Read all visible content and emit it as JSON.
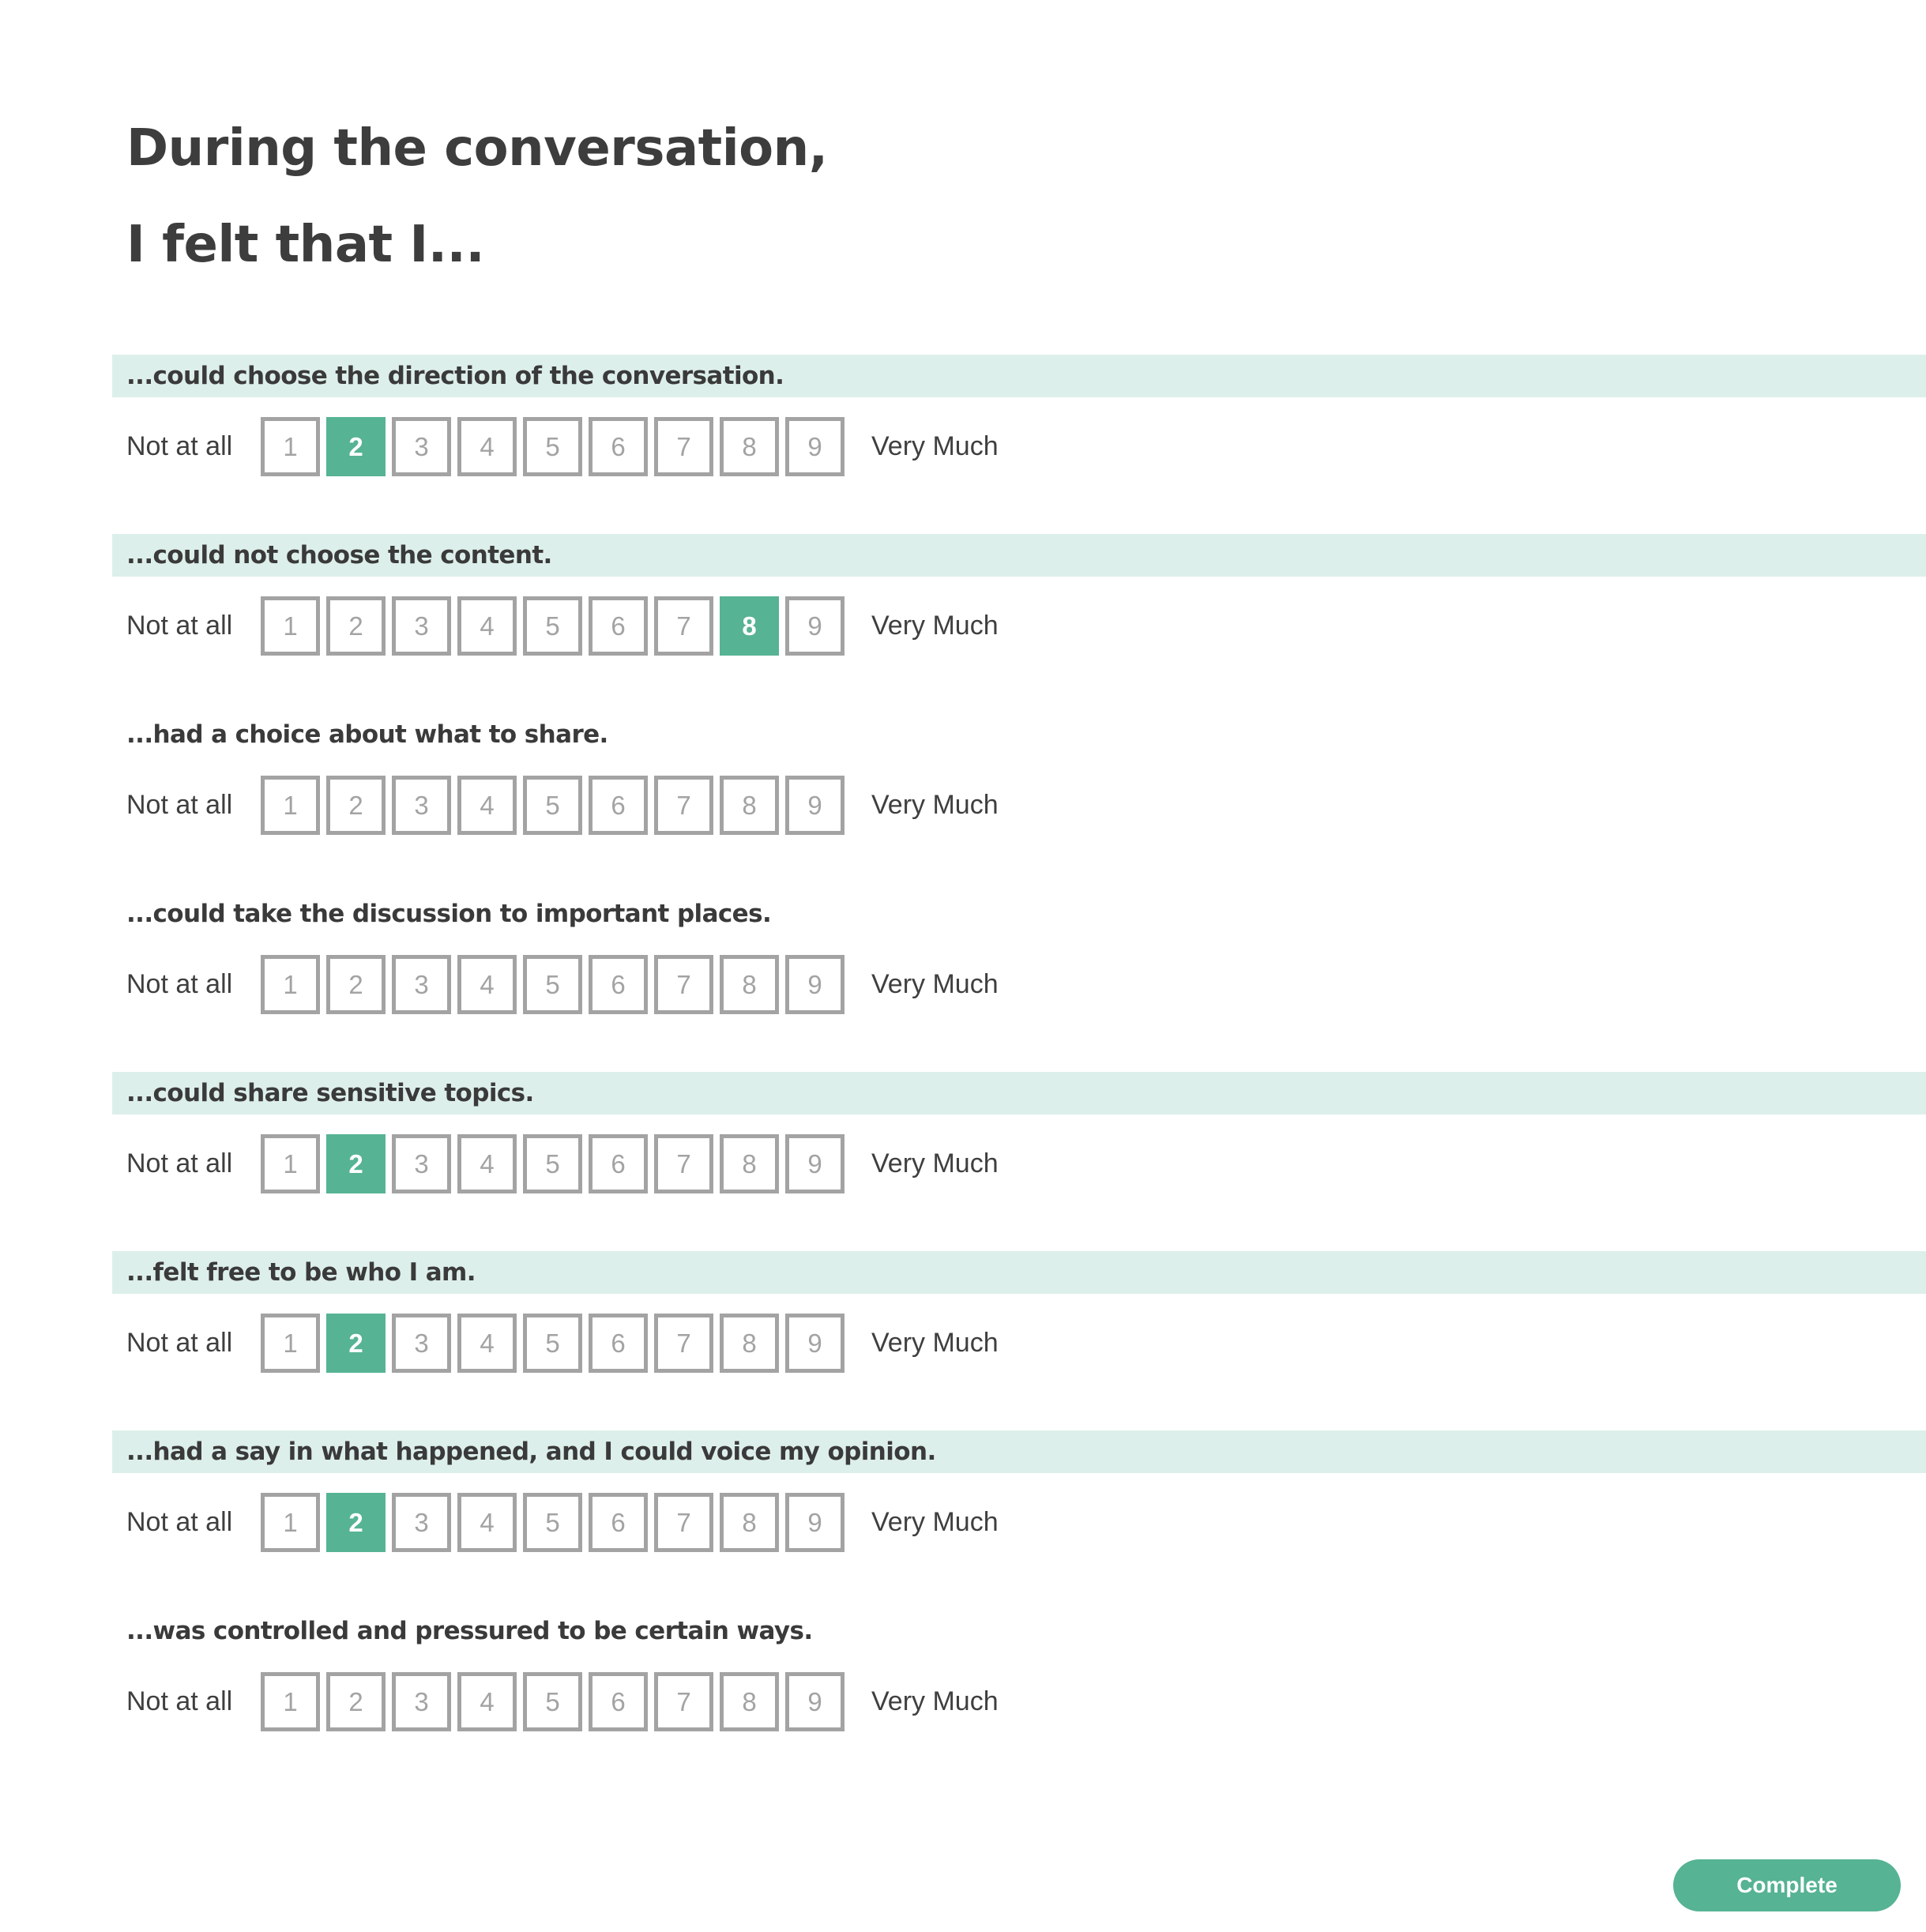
{
  "header": {
    "line1": "During the conversation,",
    "line2": "I felt that I..."
  },
  "scale": {
    "low_anchor": "Not at all",
    "high_anchor": "Very Much",
    "options": [
      "1",
      "2",
      "3",
      "4",
      "5",
      "6",
      "7",
      "8",
      "9"
    ]
  },
  "questions": [
    {
      "label": "...could choose the direction of the conversation.",
      "selected": "2",
      "highlighted": true
    },
    {
      "label": "...could not choose the content.",
      "selected": "8",
      "highlighted": true
    },
    {
      "label": "...had a choice about what to share.",
      "selected": null,
      "highlighted": false
    },
    {
      "label": "...could take the discussion to important places.",
      "selected": null,
      "highlighted": false
    },
    {
      "label": "...could share sensitive topics.",
      "selected": "2",
      "highlighted": true
    },
    {
      "label": "...felt free to be who I am.",
      "selected": "2",
      "highlighted": true
    },
    {
      "label": "...had a say in what happened, and I could voice my opinion.",
      "selected": "2",
      "highlighted": true
    },
    {
      "label": "...was controlled and pressured to be certain ways.",
      "selected": null,
      "highlighted": false
    }
  ],
  "footer": {
    "complete_label": "Complete"
  },
  "colors": {
    "accent": "#56b394",
    "highlight_band": "#ddefea",
    "box_border": "#a3a3a3"
  }
}
